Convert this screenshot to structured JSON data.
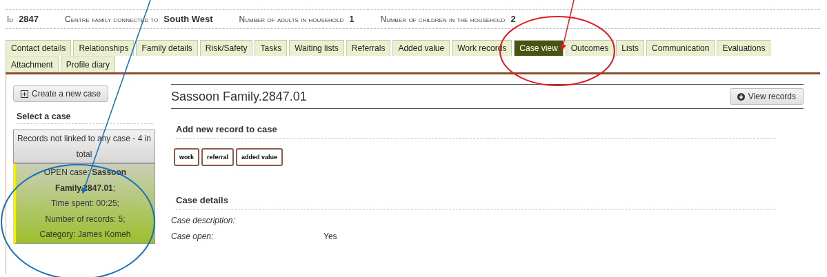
{
  "summary": [
    {
      "label": "Id",
      "value": "2847"
    },
    {
      "label": "Centre family connected to",
      "value": "South West"
    },
    {
      "label": "Number of adults in household",
      "value": "1"
    },
    {
      "label": "Number of children in the household",
      "value": "2"
    }
  ],
  "tab_rows": [
    [
      {
        "label": "Contact details",
        "selected": false
      },
      {
        "label": "Relationships",
        "selected": false
      },
      {
        "label": "Family details",
        "selected": false
      },
      {
        "label": "Risk/Safety",
        "selected": false
      },
      {
        "label": "Tasks",
        "selected": false
      },
      {
        "label": "Waiting lists",
        "selected": false
      },
      {
        "label": "Referrals",
        "selected": false
      },
      {
        "label": "Added value",
        "selected": false
      },
      {
        "label": "Work records",
        "selected": false
      },
      {
        "label": "Case view",
        "selected": true
      },
      {
        "label": "Outcomes",
        "selected": false
      },
      {
        "label": "Lists",
        "selected": false
      },
      {
        "label": "Communication",
        "selected": false
      },
      {
        "label": "Evaluations",
        "selected": false
      }
    ],
    [
      {
        "label": "Attachment",
        "selected": false
      },
      {
        "label": "Profile diary",
        "selected": false
      }
    ]
  ],
  "sidebar": {
    "create_button": "Create a new case",
    "heading": "Select a case",
    "cases": [
      {
        "kind": "unlinked",
        "lines": [
          "Records not linked to any case - 4 in total"
        ],
        "selected": false
      },
      {
        "kind": "case",
        "lines": [
          "OPEN case: **Sassoon Family.2847.01**;",
          "Time spent: 00:25;",
          "Number of records: 5;",
          "Category: James Komeh"
        ],
        "selected": true
      }
    ]
  },
  "case": {
    "title": "Sassoon Family.2847.01",
    "view_button": "View records",
    "add_heading": "Add new record to case",
    "record_buttons": [
      "work",
      "referral",
      "added value"
    ],
    "details_heading": "Case details",
    "details": [
      {
        "label": "Case description:"
      },
      {
        "label": "Case open:",
        "value": "Yes"
      }
    ]
  },
  "annotations": [
    {
      "kind": "arrow",
      "color": "#e8171f"
    },
    {
      "kind": "ellipse",
      "color": "#e8171f"
    },
    {
      "kind": "arrow",
      "color": "#1570be"
    },
    {
      "kind": "ellipse",
      "color": "#1570be"
    }
  ]
}
